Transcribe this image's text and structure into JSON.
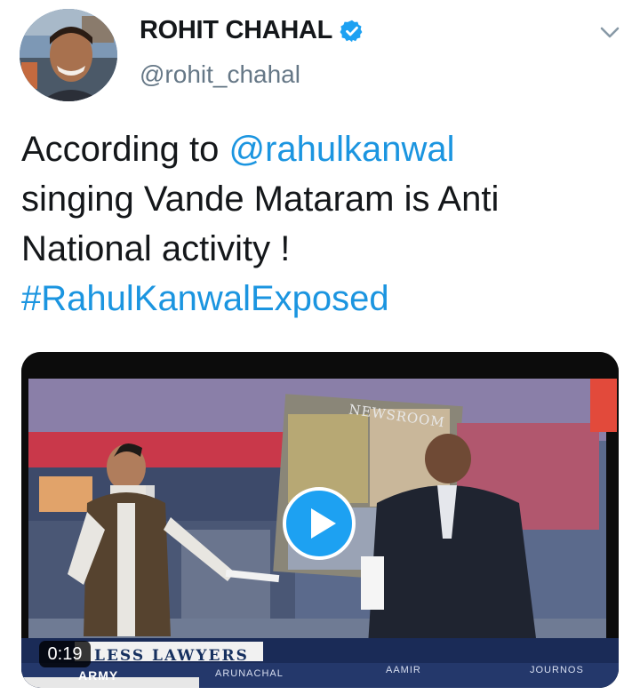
{
  "user": {
    "display_name": "ROHIT CHAHAL",
    "handle": "@rohit_chahal",
    "verified": true
  },
  "tweet": {
    "line1_prefix": "According to ",
    "mention": "@rahulkanwal",
    "line2": "singing Vande Mataram is Anti",
    "line3": "National activity !",
    "hashtag": "#RahulKanwalExposed"
  },
  "video": {
    "duration": "0:19",
    "set_sign": "NEWSROOM",
    "ticker_main": "LESS LAWYERS",
    "ticker_items": [
      "ARUNACHAL",
      "AAMIR",
      "JOURNOS"
    ],
    "ticker_army": "ARMY"
  },
  "colors": {
    "link": "#1b95e0",
    "name": "#14171a",
    "handle": "#657786",
    "play_button": "#1da1f2"
  },
  "icons": {
    "verified": "verified-badge-icon",
    "menu": "chevron-down-icon",
    "play": "play-icon"
  }
}
